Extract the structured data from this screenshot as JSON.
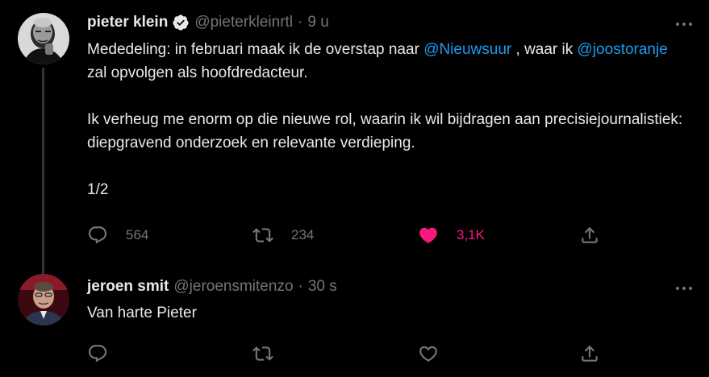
{
  "tweets": [
    {
      "author_name": "pieter klein",
      "handle": "@pieterkleinrtl",
      "separator": "·",
      "time": "9 u",
      "verified": true,
      "text": {
        "p1_a": "Mededeling: in februari maak ik de overstap naar ",
        "p1_mention1": "@Nieuwsuur",
        "p1_b": " , waar ik ",
        "p1_mention2": "@joostoranje",
        "p1_c": " zal opvolgen als hoofdredacteur.",
        "p2": "Ik verheug me enorm op die nieuwe rol, waarin ik wil bijdragen aan precisiejournalistiek: diepgravend onderzoek en relevante verdieping.",
        "p3": "1/2"
      },
      "replies": "564",
      "retweets": "234",
      "likes": "3,1K",
      "liked": true
    },
    {
      "author_name": "jeroen smit",
      "handle": "@jeroensmitenzo",
      "separator": "·",
      "time": "30 s",
      "verified": false,
      "text": {
        "p1": "Van harte Pieter"
      },
      "replies": "",
      "retweets": "",
      "likes": "",
      "liked": false
    }
  ],
  "colors": {
    "background": "#000000",
    "text": "#e7e9ea",
    "muted": "#71767b",
    "mention": "#1d9bf0",
    "like_active": "#f91880",
    "thread_line": "#333639"
  },
  "icons": {
    "more": "more-icon",
    "verified": "verified-badge-icon",
    "reply": "reply-icon",
    "retweet": "retweet-icon",
    "like": "heart-icon",
    "share": "share-icon"
  }
}
